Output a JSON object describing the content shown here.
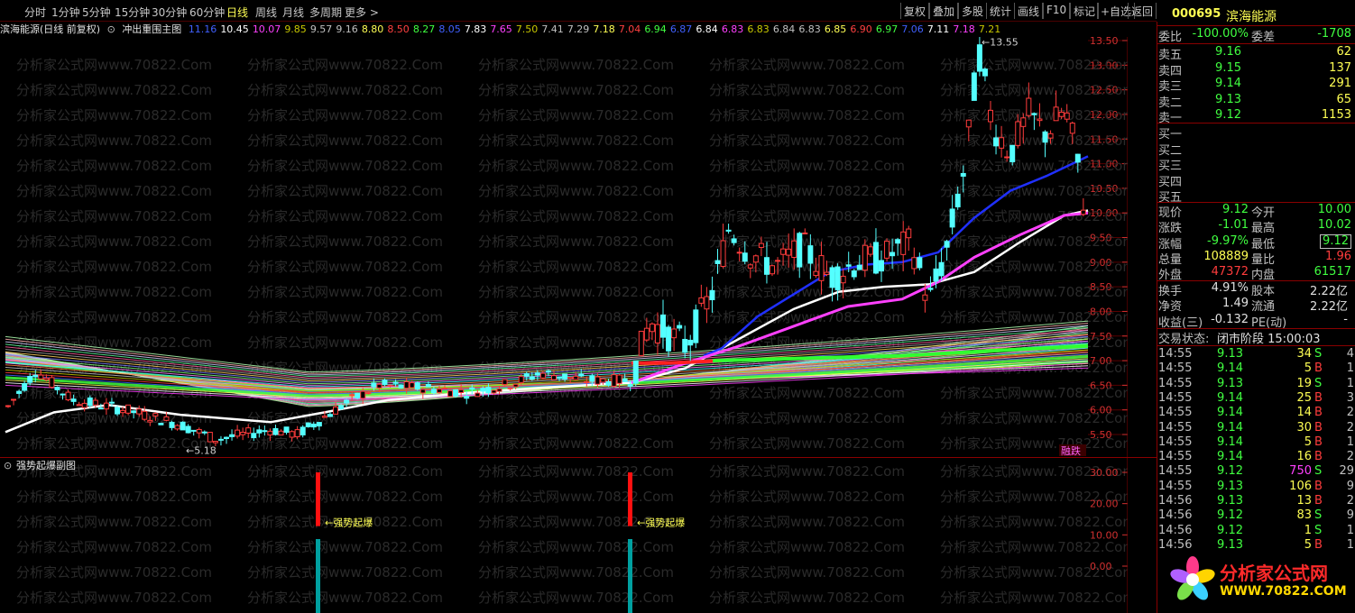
{
  "toolbar": {
    "periods": [
      "分时",
      "1分钟",
      "5分钟",
      "15分钟",
      "30分钟",
      "60分钟",
      "日线",
      "周线",
      "月线",
      "多周期",
      "更多 >"
    ],
    "active_period": "日线",
    "right_buttons": [
      "复权",
      "叠加",
      "多股",
      "统计",
      "画线",
      "F10",
      "标记",
      "+自选",
      "返回"
    ]
  },
  "chart_header": {
    "title": "滨海能源(日线 前复权)",
    "indicator": "冲出重围主图",
    "ma_values": [
      {
        "v": "11.16",
        "c": "#4060ff"
      },
      {
        "v": "10.45",
        "c": "#ffffff"
      },
      {
        "v": "10.07",
        "c": "#ff40ff"
      },
      {
        "v": "9.85",
        "c": "#c8c800"
      },
      {
        "v": "9.57",
        "c": "#c0c0c0"
      },
      {
        "v": "9.16",
        "c": "#c0c0c0"
      },
      {
        "v": "8.80",
        "c": "#ffff54"
      },
      {
        "v": "8.50",
        "c": "#ff4040"
      },
      {
        "v": "8.27",
        "c": "#40ff40"
      },
      {
        "v": "8.05",
        "c": "#4060ff"
      },
      {
        "v": "7.83",
        "c": "#ffffff"
      },
      {
        "v": "7.65",
        "c": "#ff40ff"
      },
      {
        "v": "7.50",
        "c": "#c8c800"
      },
      {
        "v": "7.41",
        "c": "#c0c0c0"
      },
      {
        "v": "7.29",
        "c": "#c0c0c0"
      },
      {
        "v": "7.18",
        "c": "#ffff54"
      },
      {
        "v": "7.04",
        "c": "#ff4040"
      },
      {
        "v": "6.94",
        "c": "#40ff40"
      },
      {
        "v": "6.87",
        "c": "#4060ff"
      },
      {
        "v": "6.84",
        "c": "#ffffff"
      },
      {
        "v": "6.83",
        "c": "#ff40ff"
      },
      {
        "v": "6.83",
        "c": "#c8c800"
      },
      {
        "v": "6.84",
        "c": "#c0c0c0"
      },
      {
        "v": "6.83",
        "c": "#c0c0c0"
      },
      {
        "v": "6.85",
        "c": "#ffff54"
      },
      {
        "v": "6.90",
        "c": "#ff4040"
      },
      {
        "v": "6.97",
        "c": "#40ff40"
      },
      {
        "v": "7.06",
        "c": "#4060ff"
      },
      {
        "v": "7.11",
        "c": "#ffffff"
      },
      {
        "v": "7.18",
        "c": "#ff40ff"
      },
      {
        "v": "7.21",
        "c": "#c8c800"
      }
    ]
  },
  "main_chart": {
    "y_ticks": [
      "13.50",
      "13.00",
      "12.50",
      "12.00",
      "11.50",
      "11.00",
      "10.50",
      "10.00",
      "9.50",
      "9.00",
      "8.50",
      "8.00",
      "7.50",
      "7.00",
      "6.50",
      "6.00",
      "5.50"
    ],
    "high_label": "13.55",
    "low_label": "5.18",
    "watermark": "分析家公式网www.70822.Com",
    "badge": "融跌"
  },
  "sub_chart": {
    "title": "强势起爆副图",
    "y_ticks": [
      "30.00",
      "20.00",
      "10.00",
      "0.00"
    ],
    "signal_label": "强势起爆"
  },
  "quote": {
    "code": "000695",
    "name": "滨海能源",
    "weibi_label": "委比",
    "weibi": "-100.00%",
    "weicha_label": "委差",
    "weicha": "-1708",
    "asks": [
      {
        "label": "卖五",
        "price": "9.16",
        "vol": "62"
      },
      {
        "label": "卖四",
        "price": "9.15",
        "vol": "137"
      },
      {
        "label": "卖三",
        "price": "9.14",
        "vol": "291"
      },
      {
        "label": "卖二",
        "price": "9.13",
        "vol": "65"
      },
      {
        "label": "卖一",
        "price": "9.12",
        "vol": "1153"
      }
    ],
    "bids": [
      {
        "label": "买一"
      },
      {
        "label": "买二"
      },
      {
        "label": "买三"
      },
      {
        "label": "买四"
      },
      {
        "label": "买五"
      }
    ],
    "stats": [
      {
        "l1": "现价",
        "v1": "9.12",
        "c1": "green",
        "l2": "今开",
        "v2": "10.00",
        "c2": "green"
      },
      {
        "l1": "涨跌",
        "v1": "-1.01",
        "c1": "green",
        "l2": "最高",
        "v2": "10.02",
        "c2": "green"
      },
      {
        "l1": "涨幅",
        "v1": "-9.97%",
        "c1": "green",
        "l2": "最低",
        "v2": "9.12",
        "c2": "green"
      },
      {
        "l1": "总量",
        "v1": "108889",
        "c1": "yellow",
        "l2": "量比",
        "v2": "1.96",
        "c2": "red"
      },
      {
        "l1": "外盘",
        "v1": "47372",
        "c1": "red",
        "l2": "内盘",
        "v2": "61517",
        "c2": "green"
      }
    ],
    "fin": [
      {
        "l1": "换手",
        "v1": "4.91%",
        "l2": "股本",
        "v2": "2.22亿"
      },
      {
        "l1": "净资",
        "v1": "1.49",
        "l2": "流通",
        "v2": "2.22亿"
      },
      {
        "l1": "收益(三)",
        "v1": "-0.132",
        "l2": "PE(动)",
        "v2": "-"
      }
    ],
    "status_label": "交易状态:",
    "status": "闭市阶段 15:00:03"
  },
  "ticks": [
    {
      "time": "14:55",
      "price": "9.13",
      "vol": "34",
      "vc": "yellow",
      "bs": "S",
      "n": "4"
    },
    {
      "time": "14:55",
      "price": "9.14",
      "vol": "5",
      "vc": "yellow",
      "bs": "B",
      "n": "1"
    },
    {
      "time": "14:55",
      "price": "9.13",
      "vol": "19",
      "vc": "yellow",
      "bs": "S",
      "n": "1"
    },
    {
      "time": "14:55",
      "price": "9.14",
      "vol": "25",
      "vc": "yellow",
      "bs": "B",
      "n": "3"
    },
    {
      "time": "14:55",
      "price": "9.14",
      "vol": "14",
      "vc": "yellow",
      "bs": "B",
      "n": "2"
    },
    {
      "time": "14:55",
      "price": "9.14",
      "vol": "30",
      "vc": "yellow",
      "bs": "B",
      "n": "2"
    },
    {
      "time": "14:55",
      "price": "9.14",
      "vol": "5",
      "vc": "yellow",
      "bs": "B",
      "n": "1"
    },
    {
      "time": "14:55",
      "price": "9.14",
      "vol": "16",
      "vc": "yellow",
      "bs": "B",
      "n": "2"
    },
    {
      "time": "14:55",
      "price": "9.12",
      "vol": "750",
      "vc": "magenta",
      "bs": "S",
      "n": "29"
    },
    {
      "time": "14:55",
      "price": "9.13",
      "vol": "106",
      "vc": "yellow",
      "bs": "B",
      "n": "9"
    },
    {
      "time": "14:56",
      "price": "9.13",
      "vol": "13",
      "vc": "yellow",
      "bs": "B",
      "n": "2"
    },
    {
      "time": "14:56",
      "price": "9.12",
      "vol": "83",
      "vc": "yellow",
      "bs": "S",
      "n": "9"
    },
    {
      "time": "14:56",
      "price": "9.12",
      "vol": "1",
      "vc": "yellow",
      "bs": "S",
      "n": "1"
    },
    {
      "time": "14:56",
      "price": "9.13",
      "vol": "5",
      "vc": "yellow",
      "bs": "B",
      "n": "1"
    }
  ],
  "logo": {
    "name": "分析家公式网",
    "url": "WWW.70822.COM"
  },
  "colors": {
    "up": "#ff3c3c",
    "down": "#54ffff",
    "grid": "#8a0000"
  }
}
